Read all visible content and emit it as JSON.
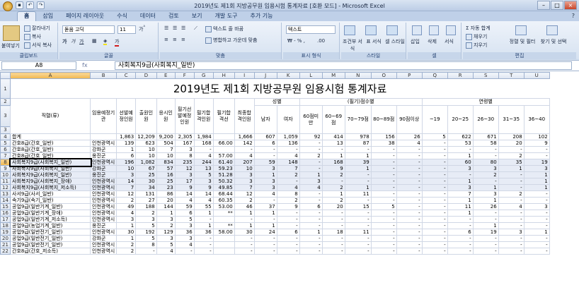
{
  "window": {
    "title": "2019년도 제1회 지방공무원 임용시험 통계자료 [호환 모드] - Microsoft Excel"
  },
  "ribbon_tabs": [
    "홈",
    "삽입",
    "페이지 레이아웃",
    "수식",
    "데이터",
    "검토",
    "보기",
    "개발 도구",
    "추가 기능"
  ],
  "ribbon": {
    "paste": "붙여넣기",
    "cut": "잘라내기",
    "copy": "복사",
    "format_painter": "서식 복사",
    "clipboard": "클립보드",
    "font_name": "돋움 고딕",
    "font_size": "11",
    "font_group": "글꼴",
    "wrap": "텍스트 줄 바꿈",
    "merge": "병합하고 가운데 맞춤",
    "align_group": "맞춤",
    "number_format": "텍스트",
    "number_group": "표시 형식",
    "cond_format": "조건부 서식",
    "table_format": "표 서식",
    "cell_style": "셀 스타일",
    "style_group": "스타일",
    "insert": "삽입",
    "delete": "삭제",
    "format": "서식",
    "cells_group": "셀",
    "autosum": "자동 합계",
    "fill": "채우기",
    "clear": "지우기",
    "sort": "정렬 및 필터",
    "find": "찾기 및 선택",
    "edit_group": "편집"
  },
  "formula_bar": {
    "name_box": "A8",
    "fx": "fx",
    "content": "사회복지9급(사회복지_일반)"
  },
  "columns": [
    "A",
    "B",
    "C",
    "D",
    "E",
    "F",
    "G",
    "H",
    "I",
    "J",
    "K",
    "L",
    "M",
    "N",
    "O",
    "P",
    "Q",
    "R",
    "S",
    "T",
    "U"
  ],
  "sheet_title": "2019년도 제1회 지방공무원 임용시험 통계자료",
  "headers": {
    "category": "직렬(류)",
    "agency": "임용예정기관",
    "planned": "선발예정인원",
    "applied": "출원인원",
    "taken": "응시인원",
    "written_pass": "필기선발예정인원",
    "pass_count": "필기합격인원",
    "pass_score": "필기합격선",
    "final": "최종합격인원",
    "gender": "성별",
    "male": "남자",
    "female": "여자",
    "score_group": "(필기)점수별",
    "s1": "60점미만",
    "s2": "60~69점",
    "s3": "70~79점",
    "s4": "80~89점",
    "s5": "90점이상",
    "age_group": "연령별",
    "a1": "~19",
    "a2": "20~25",
    "a3": "26~30",
    "a4": "31~35",
    "a5": "36~40"
  },
  "rows": [
    {
      "n": "4",
      "c": [
        "합계",
        "",
        "1,863",
        "12,209",
        "9,200",
        "2,305",
        "1,984",
        "",
        "1,666",
        "607",
        "1,059",
        "92",
        "414",
        "978",
        "156",
        "26",
        "5",
        "622",
        "671",
        "208",
        "102"
      ]
    },
    {
      "n": "5",
      "c": [
        "간호8급(간호_일반)",
        "인천광역시",
        "139",
        "623",
        "504",
        "167",
        "168",
        "66.00",
        "142",
        "6",
        "136",
        "-",
        "13",
        "87",
        "38",
        "4",
        "-",
        "53",
        "58",
        "20",
        "9"
      ]
    },
    {
      "n": "6",
      "c": [
        "간호8급(간호_일반)",
        "강화군",
        "1",
        "10",
        "7",
        "3",
        "-",
        "",
        "-",
        "-",
        "-",
        "-",
        "-",
        "-",
        "-",
        "-",
        "-",
        "-",
        "-",
        "-",
        "-"
      ]
    },
    {
      "n": "7",
      "c": [
        "간호8급(간호_일반)",
        "옹진군",
        "6",
        "10",
        "10",
        "8",
        "4",
        "57.00",
        "4",
        "-",
        "4",
        "2",
        "1",
        "1",
        "-",
        "-",
        "-",
        "1",
        "-",
        "2",
        "-"
      ]
    },
    {
      "n": "8",
      "c": [
        "사회복지9급(사회복지_일반)",
        "인천광역시",
        "196",
        "1,082",
        "834",
        "235",
        "244",
        "61.40",
        "207",
        "59",
        "148",
        "-",
        "168",
        "39",
        "-",
        "-",
        "-",
        "60",
        "80",
        "35",
        "19"
      ]
    },
    {
      "n": "9",
      "c": [
        "사회복지9급(사회복지_일반)",
        "강화군",
        "10",
        "67",
        "57",
        "12",
        "13",
        "59.23",
        "10",
        "3",
        "7",
        "-",
        "9",
        "1",
        "-",
        "-",
        "-",
        "3",
        "3",
        "1",
        "3"
      ]
    },
    {
      "n": "10",
      "c": [
        "사회복지9급(사회복지_일반)",
        "옹진군",
        "3",
        "25",
        "16",
        "3",
        "5",
        "51.28",
        "3",
        "1",
        "2",
        "1",
        "2",
        "-",
        "-",
        "-",
        "-",
        "-",
        "2",
        "-",
        "1"
      ]
    },
    {
      "n": "11",
      "c": [
        "사회복지9급(사회복지_장애)",
        "인천광역시",
        "14",
        "30",
        "25",
        "17",
        "3",
        "50.32",
        "3",
        "3",
        "-",
        "3",
        "-",
        "-",
        "-",
        "-",
        "-",
        "1",
        "-",
        "-",
        "1"
      ]
    },
    {
      "n": "12",
      "c": [
        "사회복지9급(사회복지_저소득)",
        "인천광역시",
        "7",
        "34",
        "23",
        "9",
        "9",
        "49.85",
        "7",
        "3",
        "4",
        "4",
        "2",
        "1",
        "-",
        "-",
        "-",
        "3",
        "1",
        "-",
        "1"
      ]
    },
    {
      "n": "13",
      "c": [
        "사서9급(사서_일반)",
        "인천광역시",
        "12",
        "131",
        "86",
        "14",
        "14",
        "68.44",
        "12",
        "4",
        "8",
        "-",
        "1",
        "11",
        "-",
        "-",
        "-",
        "7",
        "3",
        "2",
        "-"
      ]
    },
    {
      "n": "14",
      "c": [
        "속기9급(속기_일반)",
        "인천광역시",
        "2",
        "27",
        "20",
        "4",
        "4",
        "60.35",
        "2",
        "-",
        "2",
        "-",
        "2",
        "-",
        "-",
        "-",
        "-",
        "1",
        "1",
        "-",
        "-"
      ]
    },
    {
      "n": "15",
      "c": [
        "공업9급(일반기계_일반)",
        "인천광역시",
        "49",
        "188",
        "144",
        "59",
        "55",
        "53.00",
        "46",
        "37",
        "9",
        "6",
        "20",
        "15",
        "5",
        "-",
        "-",
        "11",
        "26",
        "4",
        "3"
      ]
    },
    {
      "n": "16",
      "c": [
        "공업9급(일반기계_장애)",
        "인천광역시",
        "4",
        "2",
        "1",
        "6",
        "1",
        "**",
        "1",
        "1",
        "-",
        "-",
        "-",
        "-",
        "-",
        "-",
        "-",
        "1",
        "-",
        "-",
        "-"
      ]
    },
    {
      "n": "17",
      "c": [
        "공업9급(일반기계_저소득)",
        "인천광역시",
        "3",
        "3",
        "3",
        "5",
        "-",
        "",
        "-",
        "-",
        "-",
        "-",
        "-",
        "-",
        "-",
        "-",
        "-",
        "-",
        "-",
        "-",
        "-"
      ]
    },
    {
      "n": "18",
      "c": [
        "공업9급(농업기계_일반)",
        "옹진군",
        "1",
        "5",
        "2",
        "3",
        "1",
        "**",
        "1",
        "1",
        "-",
        "-",
        "-",
        "-",
        "-",
        "-",
        "-",
        "-",
        "1",
        "-",
        "-"
      ]
    },
    {
      "n": "19",
      "c": [
        "공업9급(일반전기_일반)",
        "인천광역시",
        "30",
        "192",
        "129",
        "36",
        "36",
        "58.00",
        "30",
        "24",
        "6",
        "1",
        "18",
        "11",
        "-",
        "-",
        "-",
        "6",
        "19",
        "3",
        "1"
      ]
    },
    {
      "n": "20",
      "c": [
        "공업9급(일반전기_일반)",
        "강화군",
        "1",
        "5",
        "3",
        "3",
        "-",
        "",
        "-",
        "-",
        "-",
        "-",
        "-",
        "-",
        "-",
        "-",
        "-",
        "-",
        "-",
        "-",
        "-"
      ]
    },
    {
      "n": "21",
      "c": [
        "공업9급(일반전기_일반)",
        "인천광역시",
        "2",
        "8",
        "5",
        "4",
        "-",
        "",
        "-",
        "-",
        "-",
        "-",
        "-",
        "-",
        "-",
        "-",
        "-",
        "-",
        "-",
        "-",
        "-"
      ]
    },
    {
      "n": "22",
      "c": [
        "간호8급(간호_저소득)",
        "인천광역시",
        "2",
        "-",
        "4",
        "-",
        "-",
        "",
        "-",
        "-",
        "-",
        "-",
        "-",
        "-",
        "-",
        "-",
        "-",
        "-",
        "-",
        "-",
        "-"
      ]
    }
  ]
}
